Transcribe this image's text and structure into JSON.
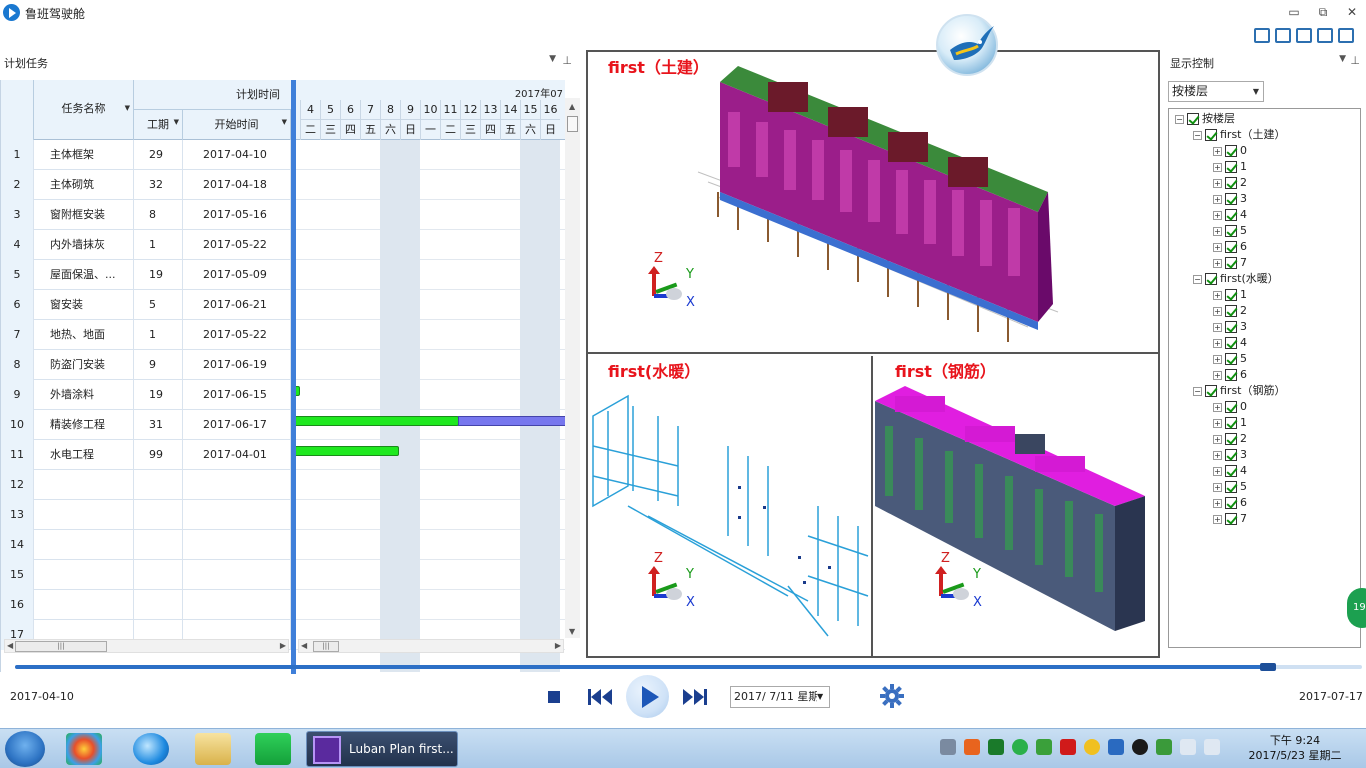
{
  "window": {
    "title": "鲁班驾驶舱",
    "controls": [
      "▭",
      "⧉",
      "✕"
    ]
  },
  "left_panel": {
    "title": "计划任务",
    "columns": {
      "name": "任务名称",
      "plan_time": "计划时间",
      "duration": "工期",
      "start": "开始时间"
    },
    "rows": [
      {
        "idx": "1",
        "name": "主体框架",
        "dur": "29",
        "start": "2017-04-10"
      },
      {
        "idx": "2",
        "name": "主体砌筑",
        "dur": "32",
        "start": "2017-04-18"
      },
      {
        "idx": "3",
        "name": "窗附框安装",
        "dur": "8",
        "start": "2017-05-16"
      },
      {
        "idx": "4",
        "name": "内外墙抹灰",
        "dur": "1",
        "start": "2017-05-22"
      },
      {
        "idx": "5",
        "name": "屋面保温、...",
        "dur": "19",
        "start": "2017-05-09"
      },
      {
        "idx": "6",
        "name": "窗安装",
        "dur": "5",
        "start": "2017-06-21"
      },
      {
        "idx": "7",
        "name": "地热、地面",
        "dur": "1",
        "start": "2017-05-22"
      },
      {
        "idx": "8",
        "name": "防盗门安装",
        "dur": "9",
        "start": "2017-06-19"
      },
      {
        "idx": "9",
        "name": "外墙涂料",
        "dur": "19",
        "start": "2017-06-15"
      },
      {
        "idx": "10",
        "name": "精装修工程",
        "dur": "31",
        "start": "2017-06-17"
      },
      {
        "idx": "11",
        "name": "水电工程",
        "dur": "99",
        "start": "2017-04-01"
      },
      {
        "idx": "12",
        "name": "",
        "dur": "",
        "start": ""
      },
      {
        "idx": "13",
        "name": "",
        "dur": "",
        "start": ""
      },
      {
        "idx": "14",
        "name": "",
        "dur": "",
        "start": ""
      },
      {
        "idx": "15",
        "name": "",
        "dur": "",
        "start": ""
      },
      {
        "idx": "16",
        "name": "",
        "dur": "",
        "start": ""
      },
      {
        "idx": "17",
        "name": "",
        "dur": "",
        "start": ""
      }
    ],
    "gantt": {
      "month": "2017年07",
      "days": [
        "4",
        "5",
        "6",
        "7",
        "8",
        "9",
        "10",
        "11",
        "12",
        "13",
        "14",
        "15",
        "16"
      ],
      "weekdays": [
        "二",
        "三",
        "四",
        "五",
        "六",
        "日",
        "一",
        "二",
        "三",
        "四",
        "五",
        "六",
        "日"
      ]
    }
  },
  "views": {
    "top_title": "first（土建）",
    "bottom_left_title": "first(水暖）",
    "bottom_right_title": "first（钢筋）",
    "axis": {
      "z": "Z",
      "y": "Y",
      "x": "X"
    }
  },
  "right_panel": {
    "title": "显示控制",
    "combo_value": "按楼层",
    "tree_root": "按楼层",
    "groups": [
      {
        "label": "first（土建）",
        "items": [
          "0",
          "1",
          "2",
          "3",
          "4",
          "5",
          "6",
          "7"
        ]
      },
      {
        "label": "first(水暖）",
        "items": [
          "1",
          "2",
          "3",
          "4",
          "5",
          "6"
        ]
      },
      {
        "label": "first（钢筋）",
        "items": [
          "0",
          "1",
          "2",
          "3",
          "4",
          "5",
          "6",
          "7"
        ]
      }
    ]
  },
  "playback": {
    "start_date": "2017-04-10",
    "end_date": "2017-07-17",
    "current_date": "2017/ 7/11 星期",
    "progress": 0.93
  },
  "side_badge": "19",
  "taskbar": {
    "active_task": "Luban Plan first...",
    "time": "下午 9:24",
    "date": "2017/5/23 星期二"
  },
  "colors": {
    "accent": "#2c6fc6",
    "bar_green": "#1ee81e",
    "bar_blue": "#7777ee",
    "view_title": "#e8141c"
  }
}
